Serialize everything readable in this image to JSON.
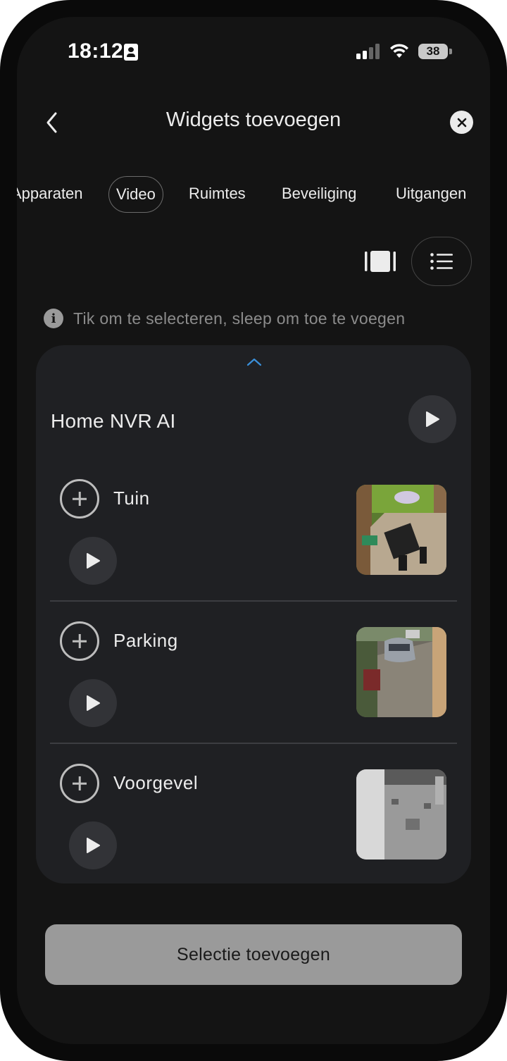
{
  "status_bar": {
    "time": "18:12",
    "battery": "38"
  },
  "header": {
    "title": "Widgets toevoegen"
  },
  "tabs": [
    {
      "label": "Apparaten",
      "active": false
    },
    {
      "label": "Video",
      "active": true
    },
    {
      "label": "Ruimtes",
      "active": false
    },
    {
      "label": "Beveiliging",
      "active": false
    },
    {
      "label": "Uitgangen",
      "active": false
    }
  ],
  "view_toggle": {
    "selected": "list"
  },
  "hint": {
    "text": "Tik om te selecteren, sleep om toe te voegen"
  },
  "group": {
    "title": "Home NVR AI",
    "cameras": [
      {
        "name": "Tuin"
      },
      {
        "name": "Parking"
      },
      {
        "name": "Voorgevel"
      }
    ]
  },
  "footer": {
    "button_label": "Selectie toevoegen"
  },
  "colors": {
    "background": "#141414",
    "card": "#1f2023",
    "accent": "#3a8fd9",
    "button": "#9a9a9a"
  }
}
